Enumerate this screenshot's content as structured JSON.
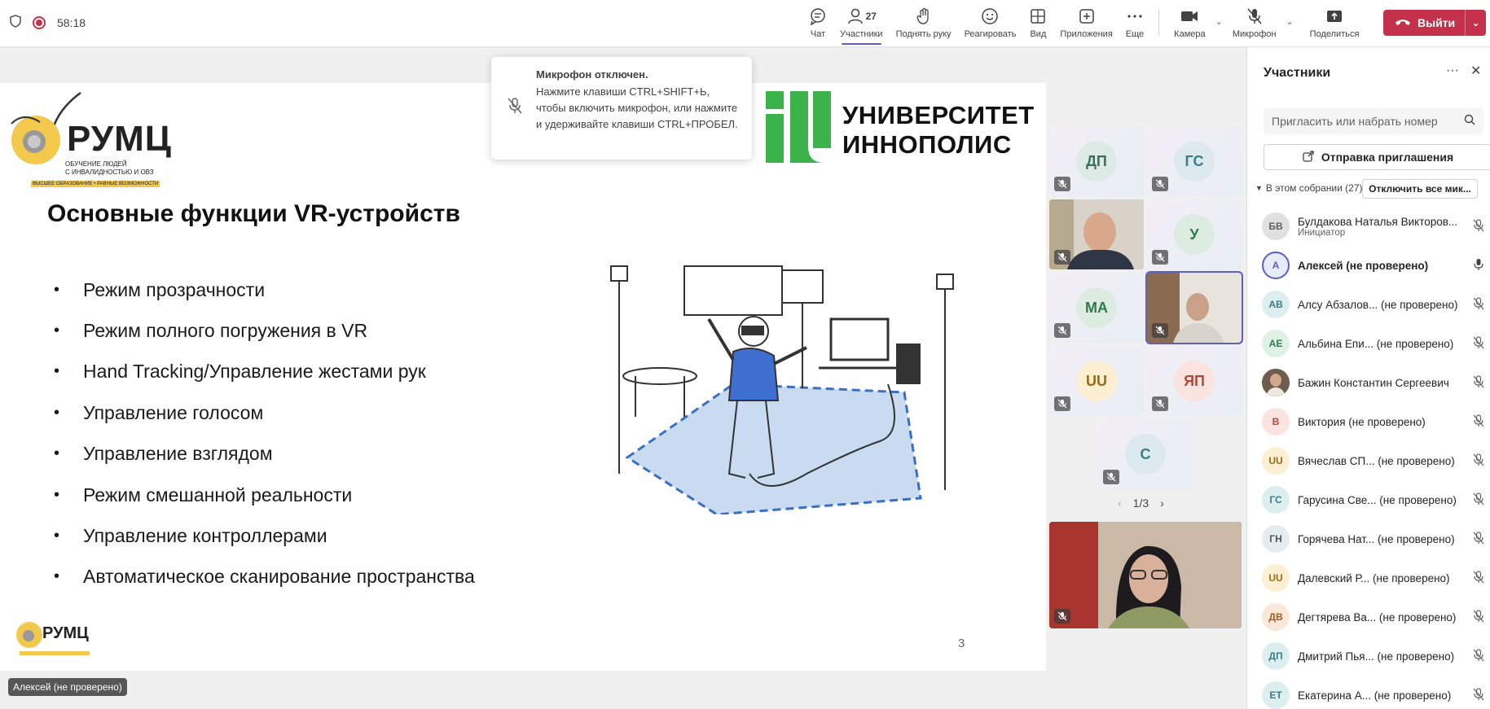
{
  "timer": "58:18",
  "toolbar": {
    "chat": "Чат",
    "participants_count": "27",
    "participants": "Участники",
    "raise_hand": "Поднять руку",
    "react": "Реагировать",
    "view": "Вид",
    "apps": "Приложения",
    "more": "Еще",
    "camera": "Камера",
    "mic": "Микрофон",
    "share": "Поделиться",
    "leave": "Выйти"
  },
  "toast": {
    "title": "Микрофон отключен.",
    "body": "Нажмите клавиши CTRL+SHIFT+Ь, чтобы включить микрофон, или нажмите и удерживайте клавиши CTRL+ПРОБЕЛ."
  },
  "slide": {
    "logo_text": "РУМЦ",
    "logo_sub1": "ОБУЧЕНИЕ ЛЮДЕЙ",
    "logo_sub2": "С ИНВАЛИДНОСТЬЮ И ОВЗ",
    "logo_sub3": "ВЫСШЕЕ ОБРАЗОВАНИЕ • РАВНЫЕ ВОЗМОЖНОСТИ",
    "university_line1": "УНИВЕРСИТЕТ",
    "university_line2": "ИННОПОЛИС",
    "title": "Основные функции VR-устройств",
    "bullets": [
      "Режим прозрачности",
      "Режим полного погружения в VR",
      "Hand Tracking/Управление жестами рук",
      "Управление голосом",
      "Управление взглядом",
      "Режим смешанной реальности",
      "Управление контроллерами",
      "Автоматическое сканирование пространства"
    ],
    "page": "3"
  },
  "tiles": [
    "ДП",
    "ГС",
    "У",
    "МА",
    "UU",
    "ЯП",
    "С"
  ],
  "pager": "1/3",
  "speaker_label": "Алексей (не проверено)",
  "panel": {
    "title": "Участники",
    "search_placeholder": "Пригласить или набрать номер",
    "invite": "Отправка приглашения",
    "section": "В этом собрании (27)",
    "mute_all": "Отключить все мик...",
    "people": [
      {
        "initials": "БВ",
        "name": "Булдакова Наталья Викторов...",
        "role": "Инициатор",
        "color": "#e0e0e0",
        "fg": "#616161"
      },
      {
        "initials": "А",
        "name": "Алексей (не проверено)",
        "role": "",
        "color": "#e8ebfa",
        "fg": "#5b5fc7"
      },
      {
        "initials": "АВ",
        "name": "Алсу Абзалов... (не проверено)",
        "role": "",
        "color": "#ddeef0",
        "fg": "#3a7d86"
      },
      {
        "initials": "АЕ",
        "name": "Альбина Епи... (не проверено)",
        "role": "",
        "color": "#def1e5",
        "fg": "#2f7a4d"
      },
      {
        "initials": "",
        "name": "Бажин Константин Сергеевич",
        "role": "",
        "color": "#7a6655",
        "fg": "#fff"
      },
      {
        "initials": "В",
        "name": "Виктория (не проверено)",
        "role": "",
        "color": "#fbe4e0",
        "fg": "#b3473a"
      },
      {
        "initials": "UU",
        "name": "Вячеслав СП... (не проверено)",
        "role": "",
        "color": "#fcefd2",
        "fg": "#9a6a12"
      },
      {
        "initials": "ГС",
        "name": "Гарусина Све... (не проверено)",
        "role": "",
        "color": "#ddeef0",
        "fg": "#3a7d86"
      },
      {
        "initials": "ГН",
        "name": "Горячева Нат... (не проверено)",
        "role": "",
        "color": "#e5ecef",
        "fg": "#4a5a63"
      },
      {
        "initials": "UU",
        "name": "Далевский Р... (не проверено)",
        "role": "",
        "color": "#fcefd2",
        "fg": "#9a6a12"
      },
      {
        "initials": "ДВ",
        "name": "Дегтярева Ва... (не проверено)",
        "role": "",
        "color": "#fbe8d8",
        "fg": "#a65b1c"
      },
      {
        "initials": "ДП",
        "name": "Дмитрий Пья... (не проверено)",
        "role": "",
        "color": "#ddeef0",
        "fg": "#3a7d86"
      },
      {
        "initials": "ЕТ",
        "name": "Екатерина А... (не проверено)",
        "role": "",
        "color": "#ddeef0",
        "fg": "#3a7d86"
      }
    ]
  }
}
